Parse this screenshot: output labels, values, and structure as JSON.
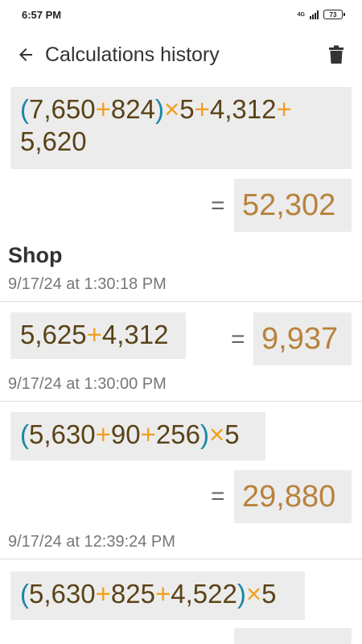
{
  "status": {
    "time": "6:57 PM",
    "network": "4G",
    "battery": "73"
  },
  "header": {
    "title": "Calculations history",
    "back_icon": "arrow-left-icon",
    "delete_icon": "trash-icon"
  },
  "entries": [
    {
      "expression": "(7,650+824)×5+4,312+5,620",
      "result": "52,302",
      "label": "Shop",
      "timestamp": "9/17/24 at 1:30:18 PM"
    },
    {
      "expression": "5,625+4,312",
      "result": "9,937",
      "timestamp": "9/17/24 at 1:30:00 PM"
    },
    {
      "expression": "(5,630+90+256)×5",
      "result": "29,880",
      "timestamp": "9/17/24 at 12:39:24 PM"
    },
    {
      "expression": "(5,630+825+4,522)×5",
      "result": ""
    }
  ],
  "equals_sign": "=",
  "colors": {
    "operator": "#f0a020",
    "parenthesis": "#1a88a8",
    "number": "#5a4318",
    "result": "#b8823c",
    "box": "#ececec"
  }
}
